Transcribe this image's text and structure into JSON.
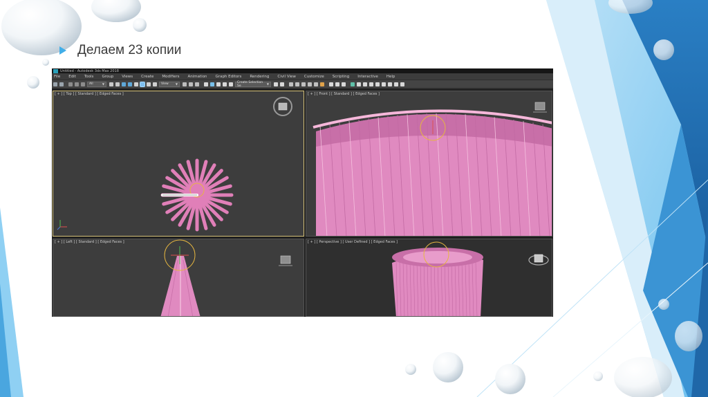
{
  "slide": {
    "title": "Делаем 23 копии",
    "accent_color": "#41aee8"
  },
  "app": {
    "window_title": "Untitled - Autodesk 3ds Max 2018",
    "menu": [
      "File",
      "Edit",
      "Tools",
      "Group",
      "Views",
      "Create",
      "Modifiers",
      "Animation",
      "Graph Editors",
      "Rendering",
      "Civil View",
      "Customize",
      "Scripting",
      "Interactive",
      "Help"
    ],
    "toolbar": {
      "filter_value": "All",
      "refcoord_value": "View",
      "selection_set_value": "Create Selection Se"
    },
    "viewports": {
      "top_label": "[ + ] [ Top ] [ Standard ] [ Edged Faces ]",
      "front_label": "[ + ] [ Front ] [ Standard ] [ Edged Faces ]",
      "left_label": "[ + ] [ Left ] [ Standard ] [ Edged Faces ]",
      "perspective_label": "[ + ] [ Perspective ] [ User Defined ] [ Edged Faces ]"
    },
    "object_color": "#e07fb8",
    "copies_count": 24
  }
}
